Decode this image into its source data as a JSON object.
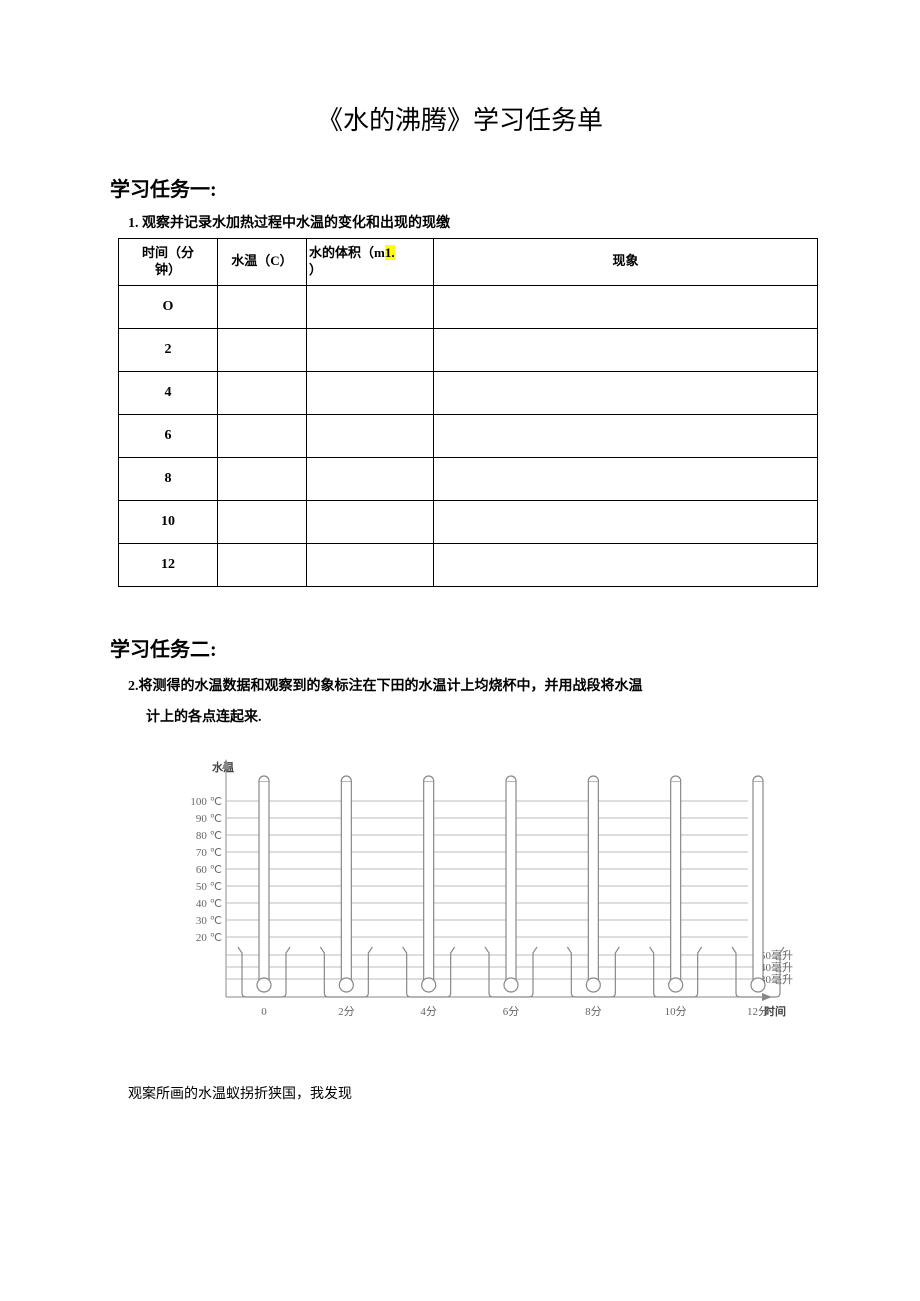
{
  "title": "《水的沸腾》学习任务单",
  "section1": {
    "heading": "学习任务一:",
    "instruction_num": "1.",
    "instruction_text": "观察并记录水加热过程中水温的变化和出现的现缴",
    "headers": {
      "c1a": "时间（分",
      "c1b": "钟）",
      "c2": "水温（C）",
      "c3a": "水的体积（m",
      "c3hl": "1.",
      "c3b": "）",
      "c4": "现象"
    },
    "rows": [
      "O",
      "2",
      "4",
      "6",
      "8",
      "10",
      "12"
    ]
  },
  "section2": {
    "heading": "学习任务二:",
    "line1_num": "2.",
    "line1": "将测得的水温数据和观察到的象标注在下田的水温计上均烧杯中，并用战段将水温",
    "line2": "计上的各点连起来.",
    "note": "观案所画的水温蚁拐折狭国，我发现"
  },
  "chart_data": {
    "type": "diagram",
    "y_axis_title": "水温",
    "x_axis_title": "时间",
    "y_ticks": [
      "100 ℃",
      "90 ℃",
      "80 ℃",
      "70 ℃",
      "60 ℃",
      "50 ℃",
      "40 ℃",
      "30 ℃",
      "20 ℃"
    ],
    "y_values": [
      100,
      90,
      80,
      70,
      60,
      50,
      40,
      30,
      20
    ],
    "x_ticks": [
      "0",
      "2分",
      "4分",
      "6分",
      "8分",
      "10分",
      "12分"
    ],
    "right_ticks": [
      "50毫升",
      "40毫升",
      "30毫升"
    ]
  }
}
